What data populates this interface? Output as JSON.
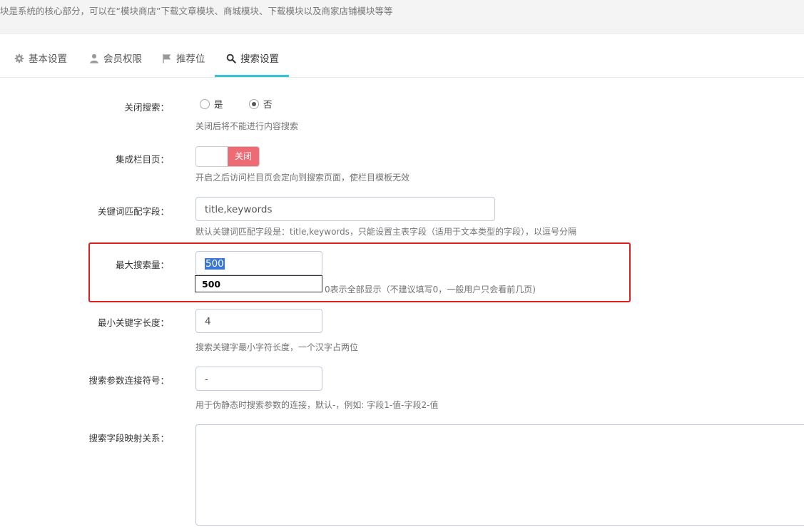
{
  "notice": {
    "text": "块是系统的核心部分，可以在“模块商店”下载文章模块、商城模块、下载模块以及商家店铺模块等等"
  },
  "tabs": [
    {
      "label": "基本设置",
      "icon": "gear-icon"
    },
    {
      "label": "会员权限",
      "icon": "user-icon"
    },
    {
      "label": "推荐位",
      "icon": "flag-icon"
    },
    {
      "label": "搜索设置",
      "icon": "search-icon",
      "active": true
    }
  ],
  "form": {
    "close_search": {
      "label": "关闭搜索：",
      "options": [
        "是",
        "否"
      ],
      "selected": "否",
      "help": "关闭后将不能进行内容搜索"
    },
    "catpage": {
      "label": "集成栏目页：",
      "switch_label": "关闭",
      "help": "开启之后访问栏目页会定向到搜索页面，使栏目模板无效"
    },
    "keyword_fields": {
      "label": "关键词匹配字段：",
      "value": "title,keywords",
      "help": "默认关键词匹配字段是：title,keywords，只能设置主表字段（适用于文本类型的字段），以逗号分隔"
    },
    "max_results": {
      "label": "最大搜索量：",
      "value": "500",
      "autocomplete": "500",
      "help": "0表示全部显示（不建议填写0，一般用户只会看前几页)"
    },
    "min_keyword_length": {
      "label": "最小关键字长度：",
      "value": "4",
      "help": "搜索关键字最小字符长度，一个汉字占两位"
    },
    "param_separator": {
      "label": "搜索参数连接符号：",
      "value": "-",
      "help": "用于伪静态时搜索参数的连接，默认-，例如: 字段1-值-字段2-值"
    },
    "field_mapping": {
      "label": "搜索字段映射关系：",
      "value": ""
    }
  },
  "colors": {
    "tab_active": "#36c6d3",
    "switch_off": "#ed6b75",
    "highlight_box": "#e02020",
    "selection": "#3a76d6"
  }
}
